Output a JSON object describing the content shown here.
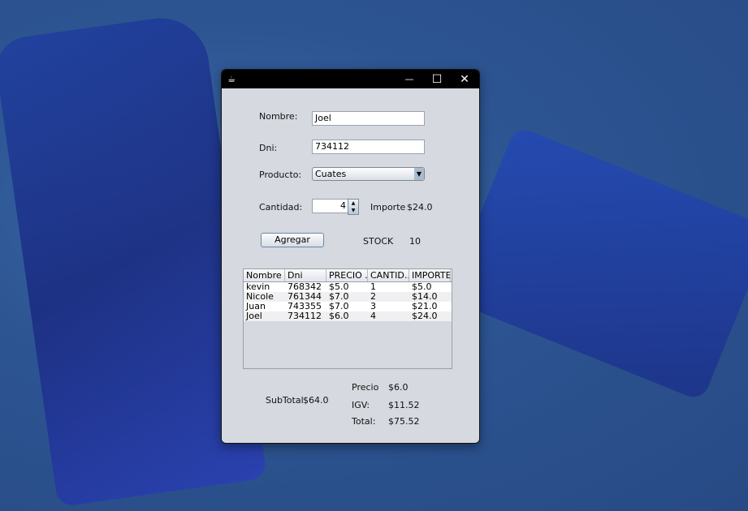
{
  "window": {
    "title": "",
    "icon": "java-icon",
    "controls": {
      "minimize": "—",
      "maximize": "☐",
      "close": "✕"
    }
  },
  "form": {
    "nombre_label": "Nombre:",
    "nombre_value": "Joel",
    "dni_label": "Dni:",
    "dni_value": "734112",
    "producto_label": "Producto:",
    "producto_value": "Cuates",
    "cantidad_label": "Cantidad:",
    "cantidad_value": "4",
    "importe_label": "Importe",
    "importe_value": "$24.0",
    "agregar_label": "Agregar",
    "stock_label": "STOCK",
    "stock_value": "10"
  },
  "table": {
    "headers": [
      "Nombre",
      "Dni",
      "PRECIO ...",
      "CANTID...",
      "IMPORTE"
    ],
    "rows": [
      [
        "kevin",
        "768342",
        "$5.0",
        "1",
        "$5.0"
      ],
      [
        "Nicole",
        "761344",
        "$7.0",
        "2",
        "$14.0"
      ],
      [
        "Juan",
        "743355",
        "$7.0",
        "3",
        "$21.0"
      ],
      [
        "Joel",
        "734112",
        "$6.0",
        "4",
        "$24.0"
      ]
    ]
  },
  "summary": {
    "subtotal_label": "SubTotal",
    "subtotal_value": "$64.0",
    "precio_label": "Precio",
    "precio_value": "$6.0",
    "igv_label": "IGV:",
    "igv_value": "$11.52",
    "total_label": "Total:",
    "total_value": "$75.52"
  }
}
